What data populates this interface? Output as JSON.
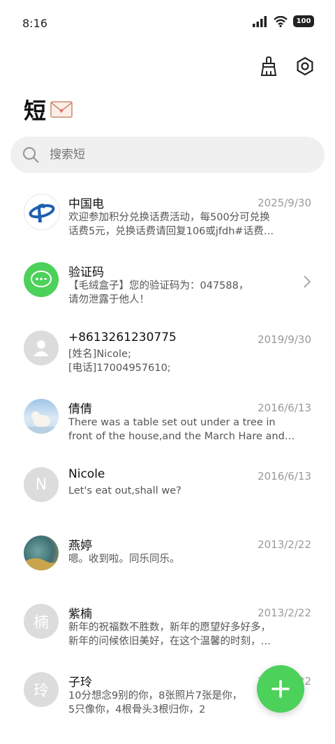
{
  "status": {
    "time": "8:16",
    "battery": "100"
  },
  "header": {
    "title": "短"
  },
  "search": {
    "placeholder": "搜索短"
  },
  "messages": [
    {
      "name": "中国电",
      "date": "2025/9/30",
      "line1": "欢迎参加积分兑换话费活动，每500分可兑换",
      "line2": "话费5元，兑换话费请回复106或jfdh#话费…"
    },
    {
      "name": "验证码",
      "date": "",
      "line1": "【毛绒盒子】您的验证码为：047588，",
      "line2": "请勿泄露于他人！"
    },
    {
      "name": "+8613261230775",
      "date": "2019/9/30",
      "line1": "[姓名]Nicole;",
      "line2": "[电话]17004957610;"
    },
    {
      "name": "倩倩",
      "date": "2016/6/13",
      "line1": "There was a table set out under a tree in",
      "line2": "front of the house,and the March Hare and…"
    },
    {
      "name": "Nicole",
      "date": "2016/6/13",
      "line1": "Let's eat out,shall we?",
      "line2": "",
      "avatar_letter": "N"
    },
    {
      "name": "燕婷",
      "date": "2013/2/22",
      "line1": "嗯。收到啦。同乐同乐。",
      "line2": ""
    },
    {
      "name": "紫楠",
      "date": "2013/2/22",
      "line1": "新年的祝福数不胜数，新年的愿望好多好多，",
      "line2": "新年的问候依旧美好，在这个温馨的时刻，…",
      "avatar_letter": "楠"
    },
    {
      "name": "子玲",
      "date": "2013/2/22",
      "line1": "10分想念9别的你，8张照片7张是你，",
      "line2": "5只像你，4根骨头3根归你，2",
      "avatar_letter": "玲"
    }
  ],
  "colors": {
    "accent": "#4cd15a",
    "telecom_blue": "#1f5fb0",
    "gray_avatar": "#dcdcdc"
  }
}
